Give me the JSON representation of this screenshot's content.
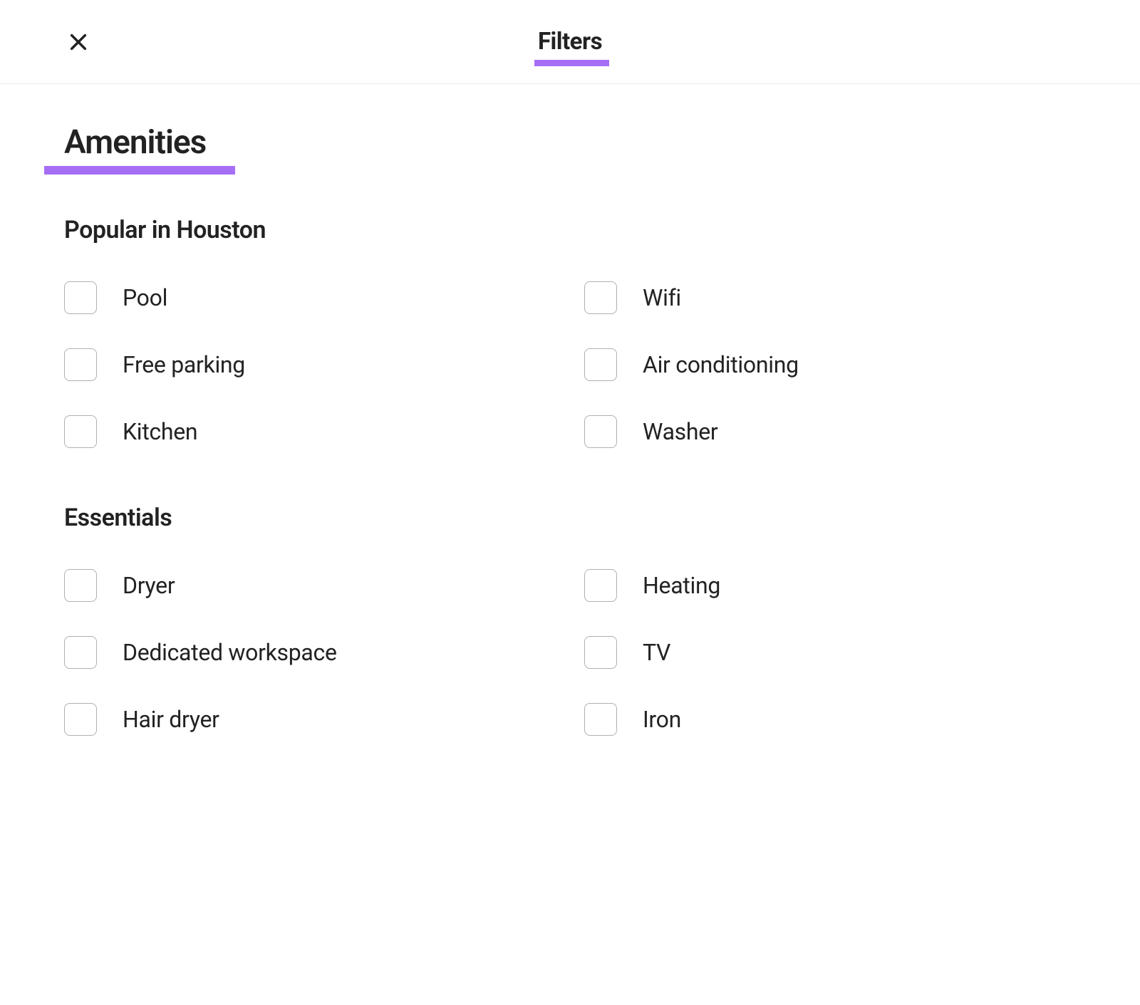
{
  "header": {
    "title": "Filters"
  },
  "amenities": {
    "title": "Amenities",
    "subsections": [
      {
        "title": "Popular in Houston",
        "options": [
          {
            "label": "Pool"
          },
          {
            "label": "Wifi"
          },
          {
            "label": "Free parking"
          },
          {
            "label": "Air conditioning"
          },
          {
            "label": "Kitchen"
          },
          {
            "label": "Washer"
          }
        ]
      },
      {
        "title": "Essentials",
        "options": [
          {
            "label": "Dryer"
          },
          {
            "label": "Heating"
          },
          {
            "label": "Dedicated workspace"
          },
          {
            "label": "TV"
          },
          {
            "label": "Hair dryer"
          },
          {
            "label": "Iron"
          }
        ]
      }
    ]
  },
  "colors": {
    "highlight": "#a66ef5"
  }
}
